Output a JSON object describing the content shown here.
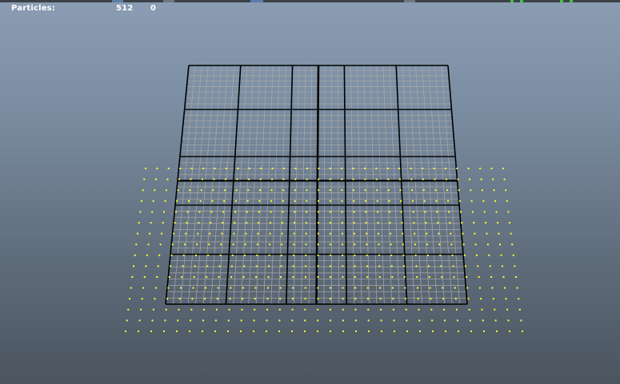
{
  "hud": {
    "particles_label": "Particles:",
    "particles_count": "512",
    "particles_extra": "0"
  },
  "colors": {
    "grid_thin": "#a9a9a9",
    "grid_major": "#000000",
    "particle": "#ffff33",
    "topbar": "#3c4148"
  },
  "toolbar_indicators": [
    "view-tab-icon",
    "shelf-tab-icon",
    "panel-tab-icon",
    "status-green-icon",
    "status-green-icon"
  ]
}
